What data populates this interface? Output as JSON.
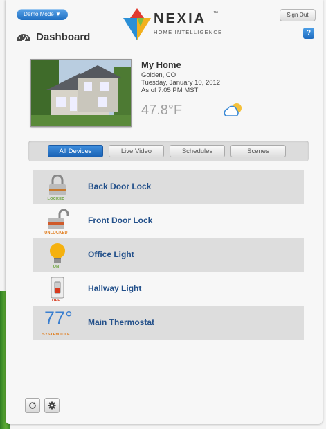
{
  "header": {
    "demo_mode_label": "Demo Mode ▼",
    "sign_out_label": "Sign Out",
    "logo_word": "NEXIA",
    "logo_tm": "™",
    "logo_tagline": "HOME INTELLIGENCE",
    "dashboard_title": "Dashboard",
    "help_label": "?"
  },
  "home": {
    "name": "My Home",
    "location": "Golden, CO",
    "date": "Tuesday, January 10, 2012",
    "as_of": "As of 7:05 PM MST",
    "temperature": "47.8°F",
    "weather_icon": "partly-cloudy-icon"
  },
  "tabs": [
    {
      "label": "All Devices",
      "active": true
    },
    {
      "label": "Live Video",
      "active": false
    },
    {
      "label": "Schedules",
      "active": false
    },
    {
      "label": "Scenes",
      "active": false
    }
  ],
  "devices": [
    {
      "name": "Back Door Lock",
      "status": "LOCKED",
      "status_color": "#6aa33a",
      "icon": "lock-locked-icon"
    },
    {
      "name": "Front Door Lock",
      "status": "UNLOCKED",
      "status_color": "#e07a18",
      "icon": "lock-unlocked-icon"
    },
    {
      "name": "Office Light",
      "status": "ON",
      "status_color": "#6aa33a",
      "icon": "lightbulb-on-icon"
    },
    {
      "name": "Hallway Light",
      "status": "OFF",
      "status_color": "#d83a1e",
      "icon": "light-switch-icon"
    },
    {
      "name": "Main Thermostat",
      "status": "SYSTEM IDLE",
      "status_color": "#e07a18",
      "icon": "thermostat-icon",
      "temperature": "77°"
    }
  ],
  "colors": {
    "accent": "#1f6fc2",
    "device_name": "#23508a"
  }
}
